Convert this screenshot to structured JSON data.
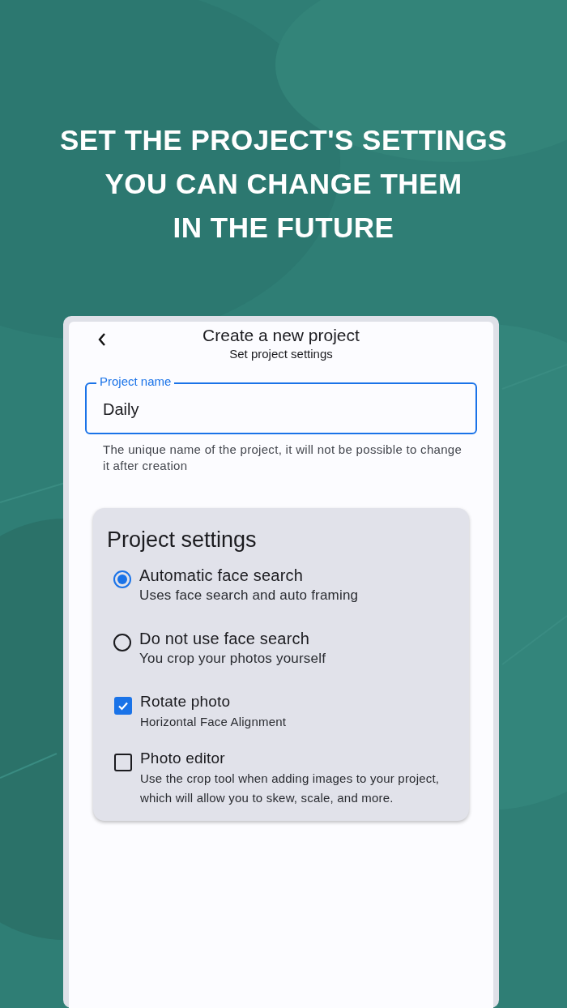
{
  "headline": {
    "lines": [
      "SET THE PROJECT'S SETTINGS",
      "YOU CAN CHANGE THEM",
      "IN THE FUTURE"
    ]
  },
  "screen": {
    "title": "Create a new project",
    "subtitle": "Set project settings",
    "name_field": {
      "label": "Project name",
      "value": "Daily",
      "focused": true,
      "helper": "The unique name of the project, it will not be possible to change it after creation"
    },
    "settings": {
      "title": "Project settings",
      "options": [
        {
          "kind": "radio",
          "label": "Automatic face search",
          "description": "Uses face search and auto framing",
          "selected": true
        },
        {
          "kind": "radio",
          "label": "Do not use face search",
          "description": "You crop your photos yourself",
          "selected": false
        },
        {
          "kind": "checkbox",
          "label": "Rotate photo",
          "description": "Horizontal Face Alignment",
          "checked": true
        },
        {
          "kind": "checkbox",
          "label": "Photo editor",
          "description": "Use the crop tool when adding images to your project, which will allow you to skew, scale, and more.",
          "checked": false
        }
      ]
    }
  }
}
